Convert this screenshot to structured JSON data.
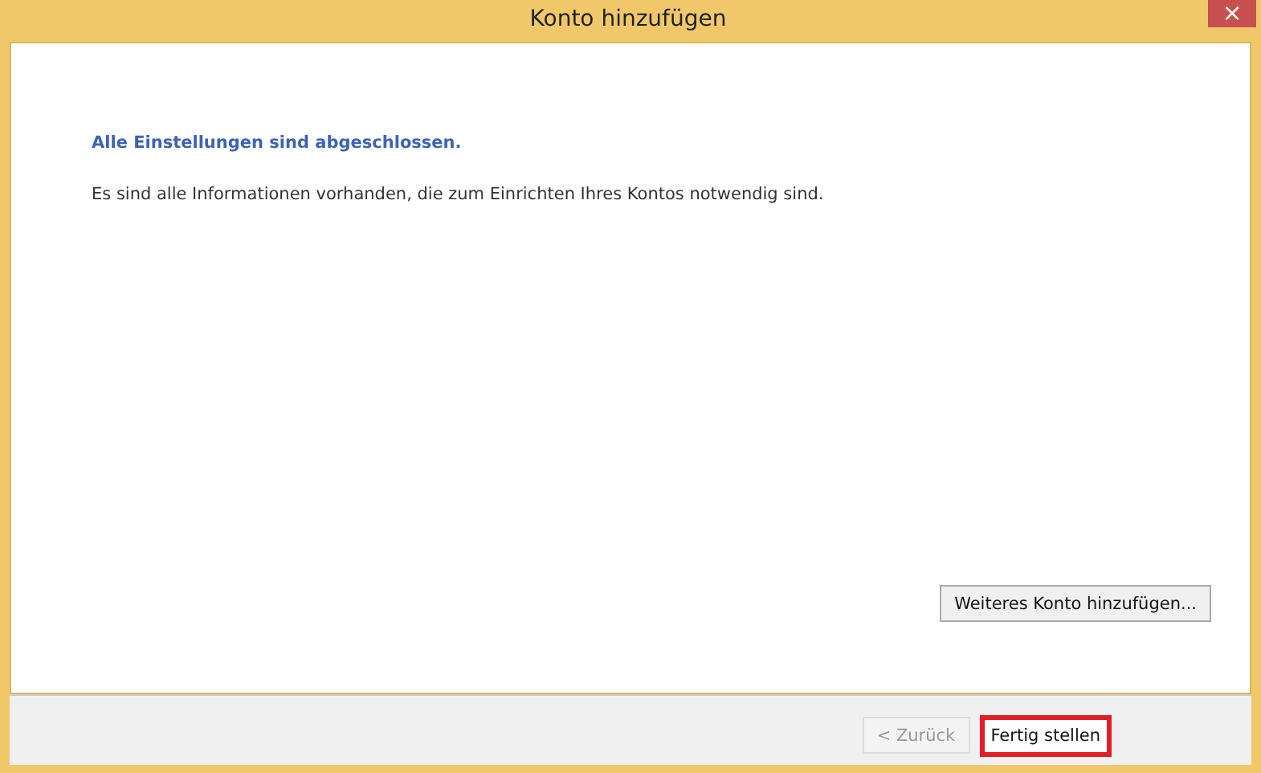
{
  "window": {
    "title": "Konto hinzufügen",
    "close": "×"
  },
  "heading": "Alle Einstellungen sind abgeschlossen.",
  "message": "Es sind alle Informationen vorhanden, die zum Einrichten Ihres Kontos notwendig sind.",
  "add_account_button": "Weiteres Konto hinzufügen...",
  "footer_buttons": [
    {
      "label": "< Zurück",
      "disabled": true,
      "highlighted": false
    },
    {
      "label": "Fertig stellen",
      "disabled": false,
      "highlighted": true
    }
  ]
}
